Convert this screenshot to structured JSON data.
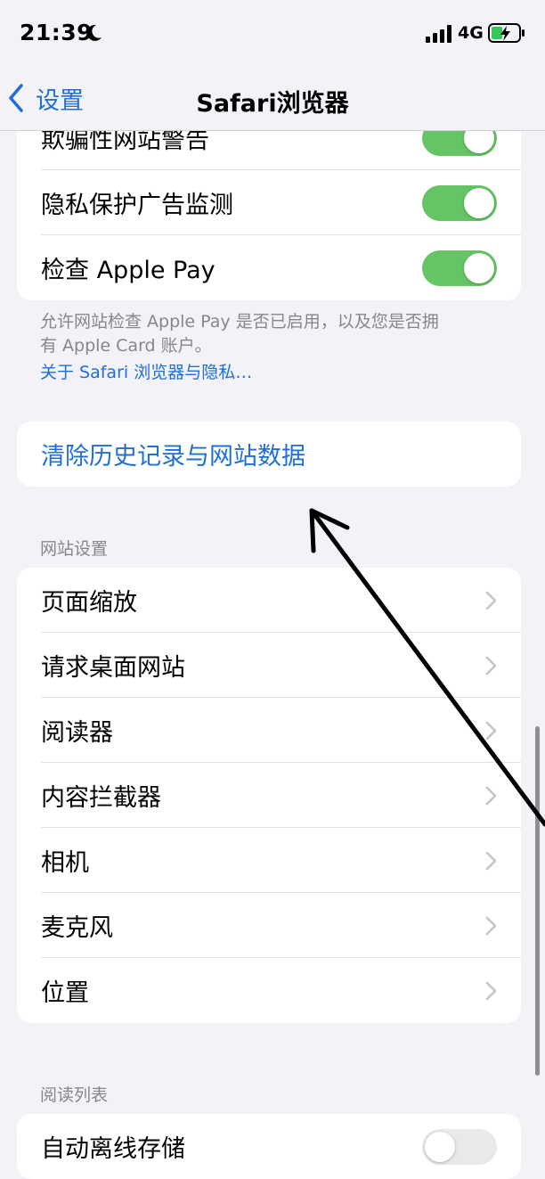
{
  "status_bar": {
    "time": "21:39",
    "network": "4G"
  },
  "nav": {
    "back_label": "设置",
    "title": "Safari浏览器"
  },
  "privacy_card": {
    "rows": [
      {
        "label": "欺骗性网站警告",
        "toggle": true
      },
      {
        "label": "隐私保护广告监测",
        "toggle": true
      },
      {
        "label": "检查 Apple Pay",
        "toggle": true
      }
    ]
  },
  "privacy_footer": {
    "line1": "允许网站检查 Apple Pay 是否已启用，以及您是否拥",
    "line2": "有 Apple Card 账户。",
    "link": "关于 Safari 浏览器与隐私…"
  },
  "clear_action": {
    "label": "清除历史记录与网站数据"
  },
  "website_settings": {
    "header": "网站设置",
    "rows": [
      {
        "label": "页面缩放"
      },
      {
        "label": "请求桌面网站"
      },
      {
        "label": "阅读器"
      },
      {
        "label": "内容拦截器"
      },
      {
        "label": "相机"
      },
      {
        "label": "麦克风"
      },
      {
        "label": "位置"
      }
    ]
  },
  "reading_list": {
    "header": "阅读列表",
    "rows": [
      {
        "label": "自动离线存储",
        "toggle": false
      }
    ]
  },
  "colors": {
    "accent": "#1f6fd6",
    "toggle_on": "#65c466",
    "background": "#f2f2f7"
  }
}
